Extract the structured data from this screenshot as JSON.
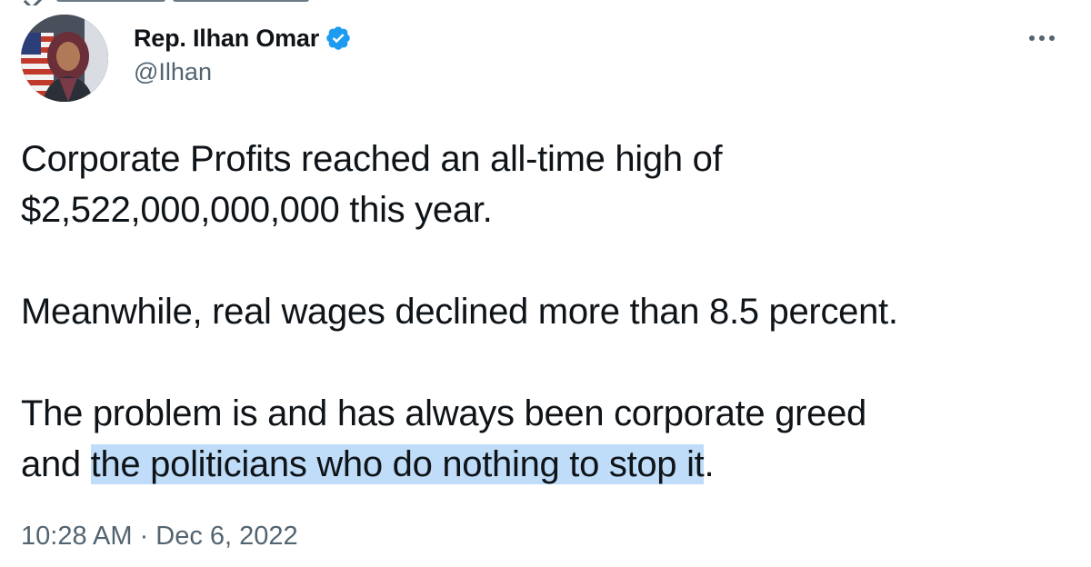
{
  "author": {
    "display_name": "Rep. Ilhan Omar",
    "handle": "@Ilhan",
    "verified": true
  },
  "icons": {
    "avatar": "profile-photo",
    "verified": "verified-badge-icon",
    "more": "more-options-icon"
  },
  "tweet": {
    "line1": "Corporate Profits reached an all-time high of",
    "line2": "$2,522,000,000,000 this year.",
    "line3": "Meanwhile, real wages declined more than 8.5 percent.",
    "line4": "The problem is and has always been corporate greed",
    "line5_prefix": "and ",
    "line5_highlight": "the politicians who do nothing to stop it",
    "line5_suffix": "."
  },
  "meta": {
    "timestamp": "10:28 AM · Dec 6, 2022"
  },
  "colors": {
    "text": "#0f1419",
    "secondary": "#536471",
    "verified_badge": "#1d9bf0",
    "selection_highlight": "#bfdcf8"
  }
}
